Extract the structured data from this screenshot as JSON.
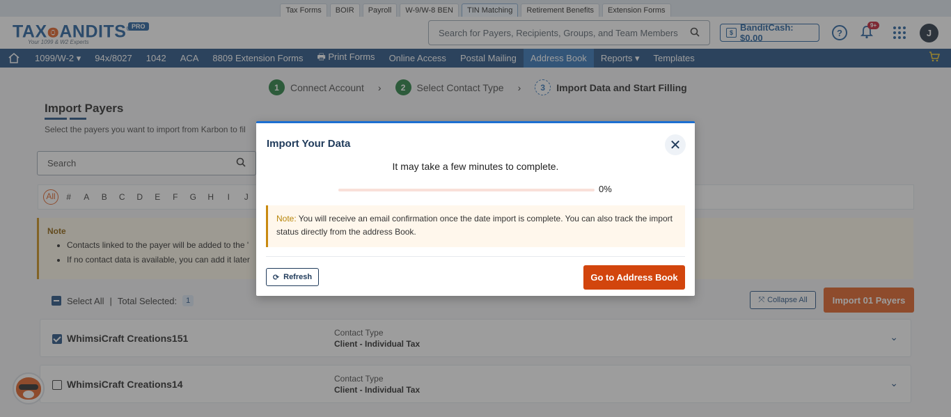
{
  "product_tabs": [
    "Tax Forms",
    "BOIR",
    "Payroll",
    "W-9/W-8 BEN",
    "TIN Matching",
    "Retirement Benefits",
    "Extension Forms"
  ],
  "header": {
    "logo_text_a": "TAX",
    "logo_text_b": "ANDITS",
    "logo_reg": "®",
    "logo_tagline": "Your 1099 & W2 Experts",
    "pro_badge": "PRO",
    "search_placeholder": "Search for Payers, Recipients, Groups, and Team Members",
    "banditcash": "BanditCash: $0.00",
    "notification_count": "9+",
    "avatar_initial": "J"
  },
  "nav": {
    "items": [
      "1099/W-2 ▾",
      "94x/8027",
      "1042",
      "ACA",
      "8809 Extension Forms",
      "🖶 Print Forms",
      "Online Access",
      "Postal Mailing",
      "Address Book",
      "Reports ▾",
      "Templates"
    ],
    "active": "Address Book"
  },
  "steps": [
    {
      "num": "1",
      "label": "Connect Account"
    },
    {
      "num": "2",
      "label": "Select Contact Type"
    },
    {
      "num": "3",
      "label": "Import Data and Start Filling"
    }
  ],
  "page": {
    "title": "Import Payers",
    "subtitle": "Select the payers you want to import from Karbon to fil",
    "search_placeholder": "Search",
    "alphabet": [
      "All",
      "#",
      "A",
      "B",
      "C",
      "D",
      "E",
      "F",
      "G",
      "H",
      "I",
      "J"
    ],
    "note_title": "Note",
    "note_items": [
      "Contacts linked to the payer will be added to the '",
      "If no contact data is available, you can add it later"
    ],
    "select_all": "Select All",
    "total_selected_label": "Total Selected:",
    "total_selected": "1",
    "collapse_all": "Collapse All",
    "import_button": "Import 01 Payers",
    "payers": [
      {
        "name": "WhimsiCraft Creations151",
        "contact_type_label": "Contact Type",
        "contact_type": "Client - Individual Tax",
        "checked": true
      },
      {
        "name": "WhimsiCraft Creations14",
        "contact_type_label": "Contact Type",
        "contact_type": "Client - Individual Tax",
        "checked": false
      }
    ]
  },
  "modal": {
    "title": "Import Your Data",
    "message": "It may take a few minutes to complete.",
    "progress": 0,
    "progress_text": "0%",
    "note_label": "Note:",
    "note_text": " You will receive an email confirmation once the date import is complete. You can also track the import status directly from the address Book.",
    "refresh_label": "Refresh",
    "goto_label": "Go to Address Book"
  },
  "colors": {
    "accent": "#e05a1d",
    "nav": "#1c4a7e",
    "primary": "#1c6fd1"
  }
}
